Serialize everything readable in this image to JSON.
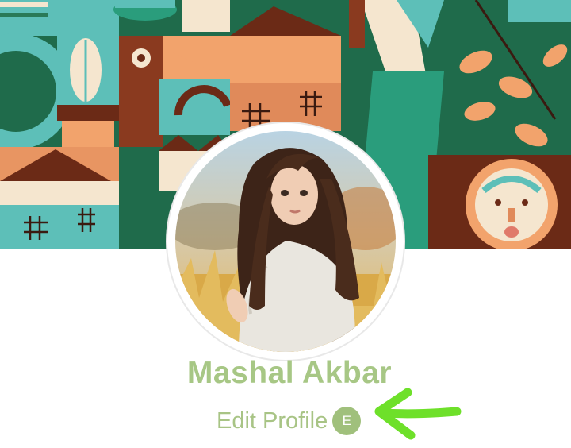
{
  "profile": {
    "name": "Mashal Akbar",
    "edit_label": "Edit Profile",
    "edit_badge": "E"
  },
  "icons": {
    "cover": "abstract-geometric-cover",
    "avatar": "illustrated-girl-avatar",
    "annotation": "green-arrow-annotation"
  },
  "colors": {
    "accent_green": "#a7c785",
    "annotation_green": "#6ee02a",
    "teal": "#5dbfb8",
    "dark_green": "#1f6b4b",
    "peach": "#f2a36c",
    "brown": "#6b2a16"
  }
}
